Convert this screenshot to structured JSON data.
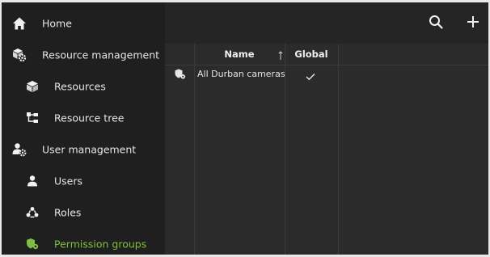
{
  "colors": {
    "accent_green": "#7fbf3f",
    "sidebar_bg": "#1f1f1f",
    "panel_bg": "#2b2b2b"
  },
  "sidebar": {
    "items": [
      {
        "label": "Home",
        "icon": "home-icon"
      },
      {
        "label": "Resource management",
        "icon": "resource-management-icon"
      },
      {
        "label": "Resources",
        "icon": "cube-icon"
      },
      {
        "label": "Resource tree",
        "icon": "tree-icon"
      },
      {
        "label": "User management",
        "icon": "user-management-icon"
      },
      {
        "label": "Users",
        "icon": "user-icon"
      },
      {
        "label": "Roles",
        "icon": "roles-icon"
      },
      {
        "label": "Permission groups",
        "icon": "permission-group-icon",
        "active": true
      }
    ]
  },
  "toolbar": {
    "search_icon": "search-icon",
    "add_icon": "plus-icon"
  },
  "table": {
    "columns": [
      {
        "label": "Name",
        "sort": "ascending"
      },
      {
        "label": "Global"
      }
    ],
    "rows": [
      {
        "name": "All Durban cameras",
        "global": true,
        "icon": "permission-group-icon"
      }
    ]
  }
}
